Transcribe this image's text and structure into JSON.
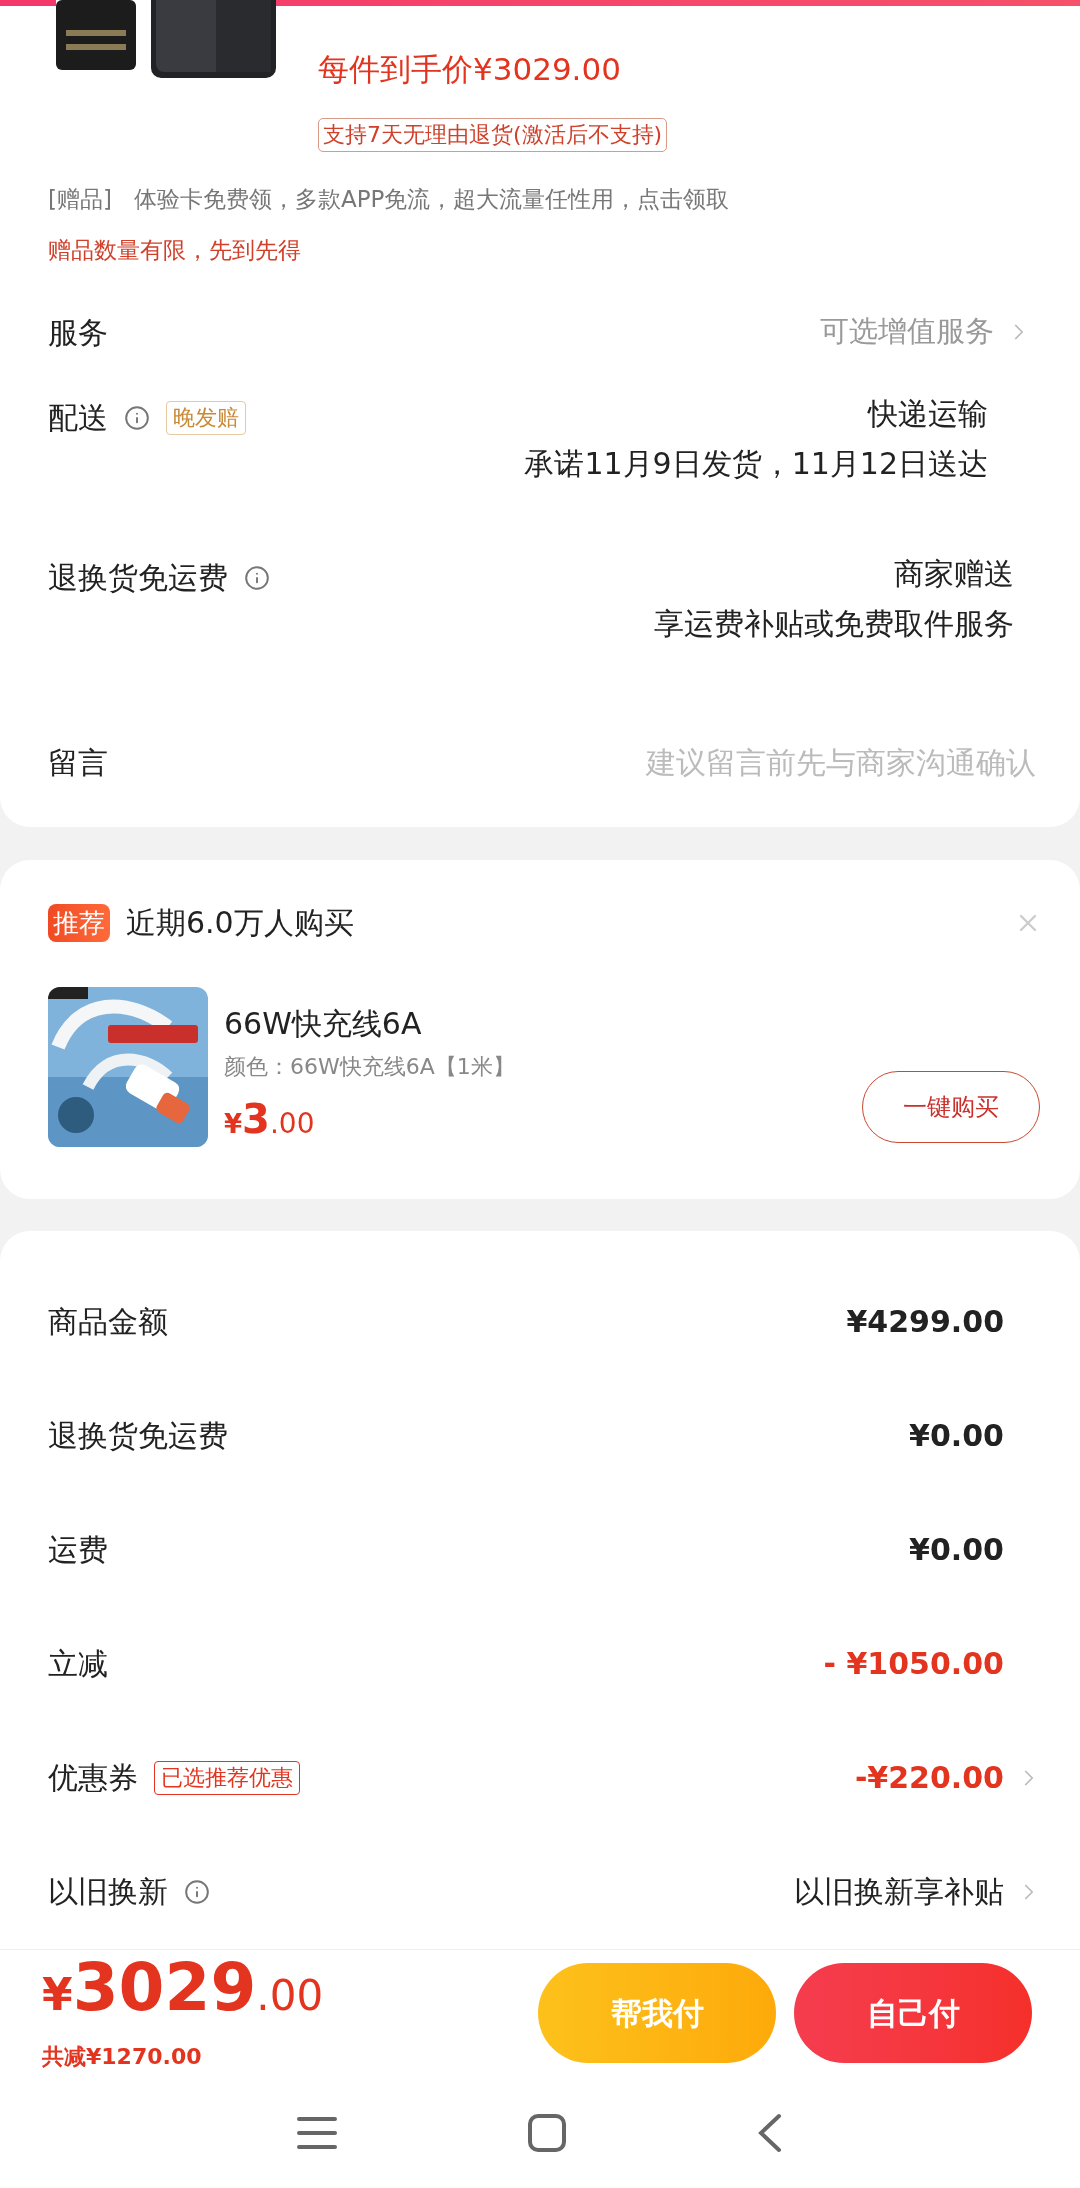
{
  "product": {
    "price_per_item": "每件到手价¥3029.00",
    "return_badge": "支持7天无理由退货(激活后不支持)",
    "gift_tag": "[赠品]",
    "gift_text": "体验卡免费领，多款APP免流，超大流量任性用，点击领取",
    "gift_notice": "赠品数量有限，先到先得"
  },
  "order_rows": [
    {
      "kind": "select",
      "label": "服务",
      "info": false,
      "value": "可选增值服务",
      "chevron": true
    },
    {
      "kind": "lines",
      "label": "配送",
      "info": true,
      "tag": "晚发赔",
      "lines": [
        "快递运输",
        "承诺11月9日发货，11月12日送达"
      ],
      "chevron": false
    },
    {
      "kind": "lines",
      "label": "退换货免运费",
      "info": true,
      "lines": [
        "商家赠送",
        "享运费补贴或免费取件服务"
      ],
      "chevron": false
    },
    {
      "kind": "input",
      "label": "留言",
      "info": false,
      "placeholder": "建议留言前先与商家沟通确认",
      "chevron": false
    }
  ],
  "recommendation": {
    "tag": "推荐",
    "title": "近期6.0万人购买",
    "item": {
      "name": "66W快充线6A",
      "spec": "颜色：66W快充线6A【1米】",
      "price_symbol": "¥",
      "price_int": "3",
      "price_dec": ".00",
      "button": "一键购买"
    }
  },
  "summary_rows": [
    {
      "kind": "amount",
      "label": "商品金额",
      "info": false,
      "value": "¥4299.00",
      "highlight": false,
      "chevron": false
    },
    {
      "kind": "amount",
      "label": "退换货免运费",
      "info": false,
      "value": "¥0.00",
      "highlight": false,
      "chevron": false
    },
    {
      "kind": "amount",
      "label": "运费",
      "info": false,
      "value": "¥0.00",
      "highlight": false,
      "chevron": false
    },
    {
      "kind": "amount",
      "label": "立减",
      "info": false,
      "value": "- ¥1050.00",
      "highlight": true,
      "chevron": false
    },
    {
      "kind": "amount",
      "label": "优惠券",
      "info": false,
      "tag": "已选推荐优惠",
      "value": "-¥220.00",
      "highlight": true,
      "chevron": true
    },
    {
      "kind": "text",
      "label": "以旧换新",
      "info": true,
      "value": "以旧换新享补贴",
      "highlight": false,
      "chevron": true
    }
  ],
  "footer": {
    "price_symbol": "¥",
    "price_int": "3029",
    "price_dec": ".00",
    "saving": "共减¥1270.00",
    "buttons": [
      {
        "label": "帮我付",
        "kind": "secondary"
      },
      {
        "label": "自己付",
        "kind": "primary"
      }
    ]
  }
}
